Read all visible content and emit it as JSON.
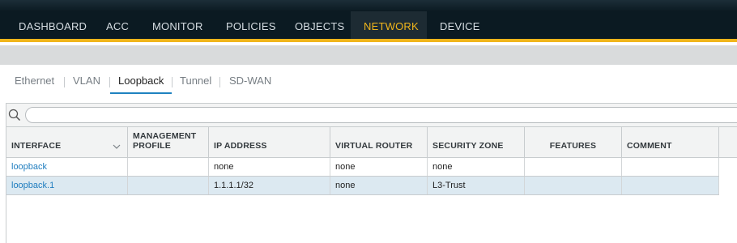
{
  "nav": {
    "items": [
      {
        "label": "DASHBOARD",
        "active": false
      },
      {
        "label": "ACC",
        "active": false
      },
      {
        "label": "MONITOR",
        "active": false
      },
      {
        "label": "POLICIES",
        "active": false
      },
      {
        "label": "OBJECTS",
        "active": false
      },
      {
        "label": "NETWORK",
        "active": true
      },
      {
        "label": "DEVICE",
        "active": false
      }
    ]
  },
  "subtabs": {
    "items": [
      {
        "label": "Ethernet",
        "active": false
      },
      {
        "label": "VLAN",
        "active": false
      },
      {
        "label": "Loopback",
        "active": true
      },
      {
        "label": "Tunnel",
        "active": false
      },
      {
        "label": "SD-WAN",
        "active": false
      }
    ]
  },
  "search": {
    "value": "",
    "placeholder": ""
  },
  "table": {
    "columns": [
      "INTERFACE",
      "MANAGEMENT PROFILE",
      "IP ADDRESS",
      "VIRTUAL ROUTER",
      "SECURITY ZONE",
      "FEATURES",
      "COMMENT"
    ],
    "rows": [
      {
        "interface": "loopback",
        "management_profile": "",
        "ip_address": "none",
        "virtual_router": "none",
        "security_zone": "none",
        "features": "",
        "comment": "",
        "selected": false
      },
      {
        "interface": "loopback.1",
        "management_profile": "",
        "ip_address": "1.1.1.1/32",
        "virtual_router": "none",
        "security_zone": "L3-Trust",
        "features": "",
        "comment": "",
        "selected": true
      }
    ]
  },
  "colors": {
    "nav_bg": "#0b1a22",
    "accent": "#f0b51b",
    "link": "#1f7dbf",
    "selected_row": "#dce9f1"
  }
}
